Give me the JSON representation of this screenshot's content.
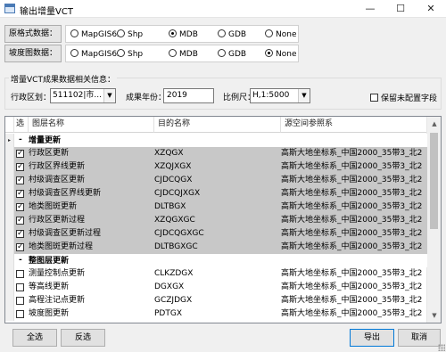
{
  "window": {
    "title": "输出增量VCT",
    "minimize": "—",
    "maximize": "☐",
    "close": "✕"
  },
  "source_format": {
    "label": "原格式数据：",
    "options": [
      "MapGIS6x",
      "Shp",
      "MDB",
      "GDB",
      "None"
    ],
    "selected": "MDB"
  },
  "slope_data": {
    "label": "坡度图数据：",
    "options": [
      "MapGIS6x",
      "Shp",
      "MDB",
      "GDB",
      "None"
    ],
    "selected": "None"
  },
  "vct_info": {
    "title": "增量VCT成果数据相关信息：",
    "region_label": "行政区划：",
    "region_value": "511102|市...",
    "year_label": "成果年份：",
    "year_value": "2019",
    "scale_label": "比例尺：",
    "scale_value": "H,1:5000",
    "keep_fields_label": "保留未配置字段",
    "keep_fields_checked": false
  },
  "grid": {
    "columns": [
      "选",
      "图层名称",
      "目的名称",
      "源空间参照系"
    ],
    "rows": [
      {
        "type": "group",
        "title": "增量更新",
        "current": true
      },
      {
        "type": "item",
        "checked": true,
        "selected": true,
        "name": "行政区更新",
        "target": "XZQGX",
        "crs": "高斯大地坐标系_中国2000_35带3_北2"
      },
      {
        "type": "item",
        "checked": true,
        "selected": true,
        "name": "行政区界线更新",
        "target": "XZQJXGX",
        "crs": "高斯大地坐标系_中国2000_35带3_北2"
      },
      {
        "type": "item",
        "checked": true,
        "selected": true,
        "name": "村级调查区更新",
        "target": "CJDCQGX",
        "crs": "高斯大地坐标系_中国2000_35带3_北2"
      },
      {
        "type": "item",
        "checked": true,
        "selected": true,
        "name": "村级调查区界线更新",
        "target": "CJDCQJXGX",
        "crs": "高斯大地坐标系_中国2000_35带3_北2"
      },
      {
        "type": "item",
        "checked": true,
        "selected": true,
        "name": "地类图斑更新",
        "target": "DLTBGX",
        "crs": "高斯大地坐标系_中国2000_35带3_北2"
      },
      {
        "type": "item",
        "checked": true,
        "selected": true,
        "name": "行政区更新过程",
        "target": "XZQGXGC",
        "crs": "高斯大地坐标系_中国2000_35带3_北2"
      },
      {
        "type": "item",
        "checked": true,
        "selected": true,
        "name": "村级调查区更新过程",
        "target": "CJDCQGXGC",
        "crs": "高斯大地坐标系_中国2000_35带3_北2"
      },
      {
        "type": "item",
        "checked": true,
        "selected": true,
        "name": "地类图斑更新过程",
        "target": "DLTBGXGC",
        "crs": "高斯大地坐标系_中国2000_35带3_北2"
      },
      {
        "type": "group",
        "title": "整图层更新",
        "current": false
      },
      {
        "type": "item",
        "checked": false,
        "selected": false,
        "name": "测量控制点更新",
        "target": "CLKZDGX",
        "crs": "高斯大地坐标系_中国2000_35带3_北2"
      },
      {
        "type": "item",
        "checked": false,
        "selected": false,
        "name": "等高线更新",
        "target": "DGXGX",
        "crs": "高斯大地坐标系_中国2000_35带3_北2"
      },
      {
        "type": "item",
        "checked": false,
        "selected": false,
        "name": "高程注记点更新",
        "target": "GCZJDGX",
        "crs": "高斯大地坐标系_中国2000_35带3_北2"
      },
      {
        "type": "item",
        "checked": false,
        "selected": false,
        "name": "坡度图更新",
        "target": "PDTGX",
        "crs": "高斯大地坐标系_中国2000_35带3_北2"
      }
    ]
  },
  "footer": {
    "select_all": "全选",
    "invert": "反选",
    "export": "导出",
    "cancel": "取消"
  },
  "icons": {
    "current_row": "triangle-right",
    "group_collapse": "minus",
    "combo_arrow": "chevron-down"
  }
}
